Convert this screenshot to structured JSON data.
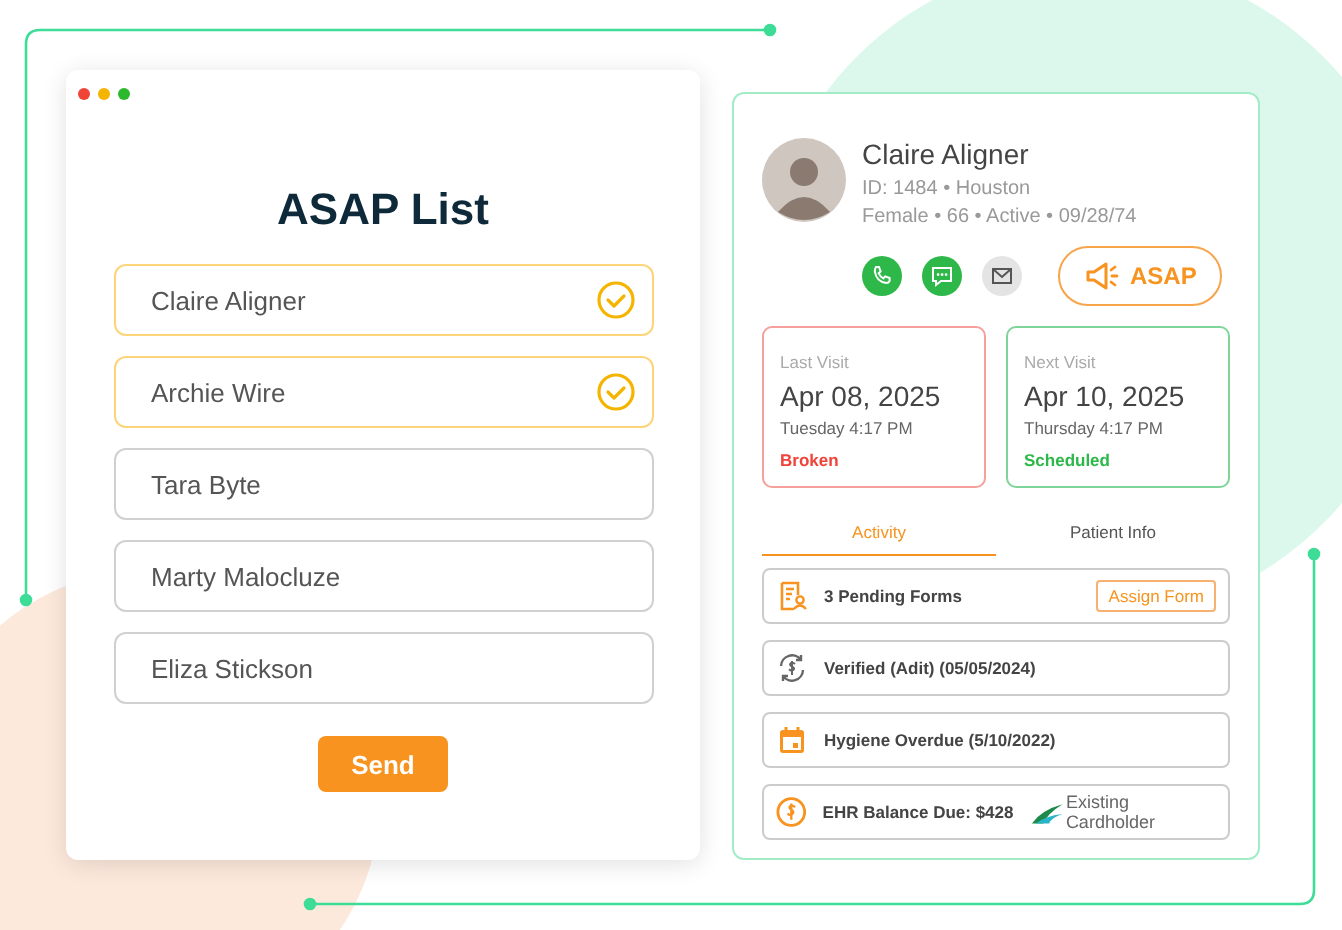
{
  "window_controls": [
    {
      "color": "#f04438"
    },
    {
      "color": "#f5b400"
    },
    {
      "color": "#2eb82e"
    }
  ],
  "asap_list": {
    "title": "ASAP List",
    "entries": [
      {
        "name": "Claire Aligner",
        "selected": true
      },
      {
        "name": "Archie Wire",
        "selected": true
      },
      {
        "name": "Tara Byte",
        "selected": false
      },
      {
        "name": "Marty Malocluze",
        "selected": false
      },
      {
        "name": "Eliza Stickson",
        "selected": false
      }
    ],
    "send_button": "Send"
  },
  "patient": {
    "name": "Claire Aligner",
    "id_line": "ID: 1484 • Houston",
    "details_line": "Female • 66 • Active • 09/28/74",
    "asap_button": "ASAP",
    "visits": [
      {
        "label": "Last Visit",
        "date": "Apr 08, 2025",
        "time": "Tuesday 4:17 PM",
        "status": "Broken",
        "kind": "broken"
      },
      {
        "label": "Next Visit",
        "date": "Apr 10, 2025",
        "time": "Thursday 4:17 PM",
        "status": "Scheduled",
        "kind": "scheduled"
      }
    ],
    "tabs": [
      {
        "label": "Activity",
        "selected": true
      },
      {
        "label": "Patient Info",
        "selected": false
      }
    ],
    "activity": [
      {
        "kind": "forms",
        "text": "3 Pending Forms",
        "action": "Assign Form"
      },
      {
        "kind": "verified",
        "text": "Verified (Adit) (05/05/2024)"
      },
      {
        "kind": "hygiene",
        "text": "Hygiene Overdue (5/10/2022)"
      },
      {
        "kind": "balance",
        "text": "EHR Balance Due: $428",
        "badge": "Existing Cardholder"
      }
    ]
  }
}
